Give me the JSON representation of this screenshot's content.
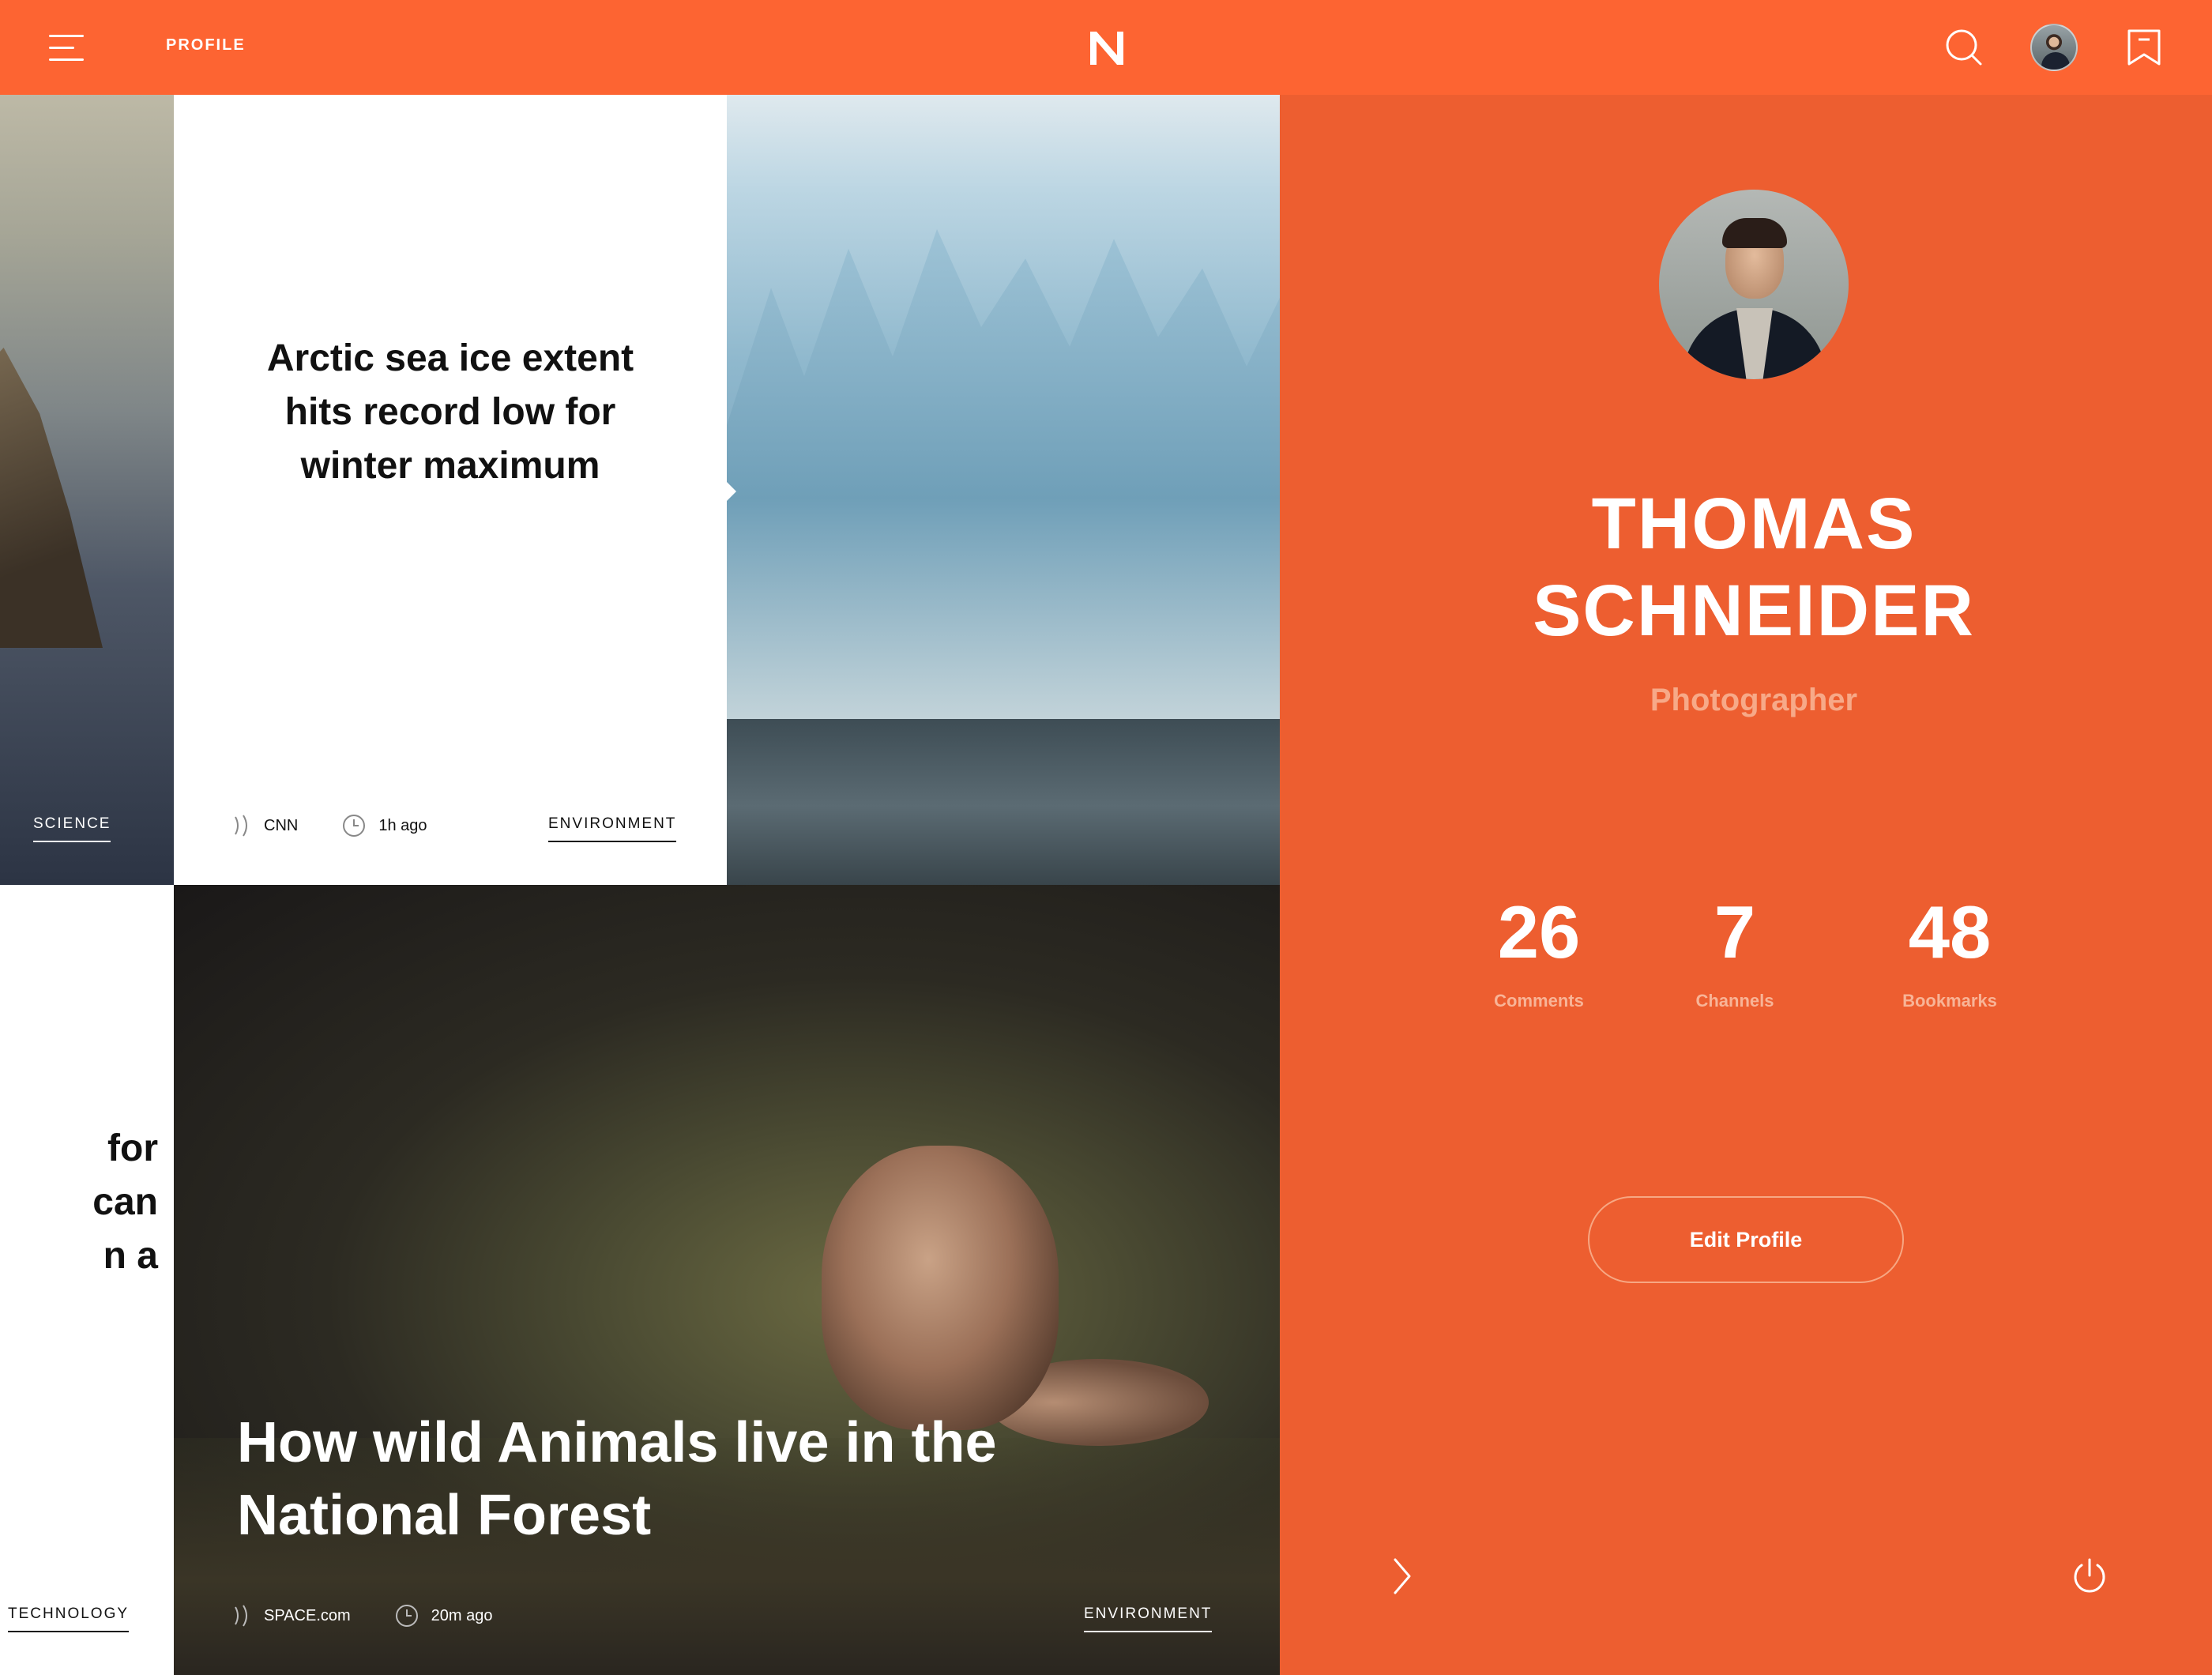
{
  "header": {
    "section_label": "PROFILE",
    "logo": "N"
  },
  "icons": {
    "menu": "hamburger-menu-icon",
    "search": "search-icon",
    "bookmark": "bookmark-icon",
    "source": "rss-source-icon",
    "time": "clock-icon",
    "next": "chevron-right-icon",
    "power": "power-icon"
  },
  "cards": {
    "cliff": {
      "tag": "SCIENCE"
    },
    "arctic": {
      "headline": "Arctic sea ice extent hits record low for winter maximum",
      "source": "CNN",
      "time": "1h ago",
      "tag": "ENVIRONMENT"
    },
    "partial": {
      "headline": "for\ncan\nn a",
      "tag": "TECHNOLOGY"
    },
    "fox": {
      "headline": "How wild Animals live in the\nNational Forest",
      "source": "SPACE.com",
      "time": "20m ago",
      "tag": "ENVIRONMENT"
    }
  },
  "profile": {
    "name": "THOMAS\nSCHNEIDER",
    "role": "Photographer",
    "stats": [
      {
        "value": "26",
        "label": "Comments"
      },
      {
        "value": "7",
        "label": "Channels"
      },
      {
        "value": "48",
        "label": "Bookmarks"
      }
    ],
    "edit_label": "Edit Profile"
  },
  "colors": {
    "header": "#fd6432",
    "panel": "#ed5e30",
    "role_text": "#f7a988"
  }
}
